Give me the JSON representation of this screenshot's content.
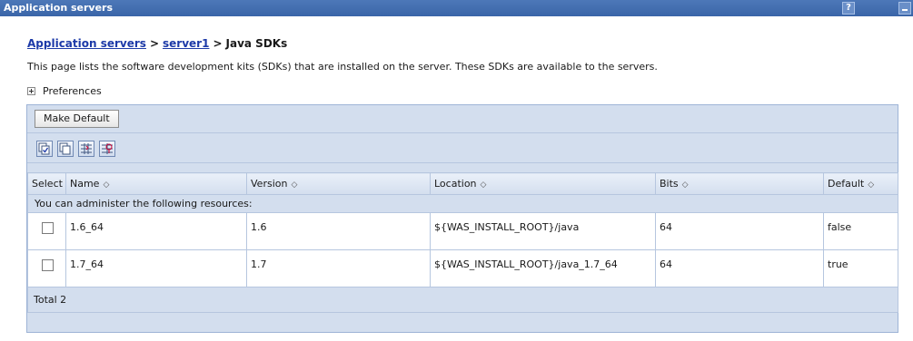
{
  "window": {
    "title": "Application servers",
    "help_label": "?"
  },
  "breadcrumb": {
    "items": [
      "Application servers",
      "server1"
    ],
    "separator": ">",
    "current": "Java SDKs"
  },
  "description": "This page lists the software development kits (SDKs) that are installed on the server. These SDKs are available to the servers.",
  "preferences": {
    "label": "Preferences"
  },
  "toolbar": {
    "make_default_label": "Make Default",
    "icons": [
      "select-all-icon",
      "deselect-all-icon",
      "show-filter-icon",
      "clear-filter-icon"
    ]
  },
  "table": {
    "columns": [
      "Select",
      "Name",
      "Version",
      "Location",
      "Bits",
      "Default"
    ],
    "resources_message": "You can administer the following resources:",
    "rows": [
      {
        "name": "1.6_64",
        "version": "1.6",
        "location": "${WAS_INSTALL_ROOT}/java",
        "bits": "64",
        "default": "false"
      },
      {
        "name": "1.7_64",
        "version": "1.7",
        "location": "${WAS_INSTALL_ROOT}/java_1.7_64",
        "bits": "64",
        "default": "true"
      }
    ],
    "total_label": "Total 2"
  },
  "colors": {
    "titlebar": "#3a65a8",
    "link": "#1d3aa8",
    "panel": "#d3deee"
  }
}
